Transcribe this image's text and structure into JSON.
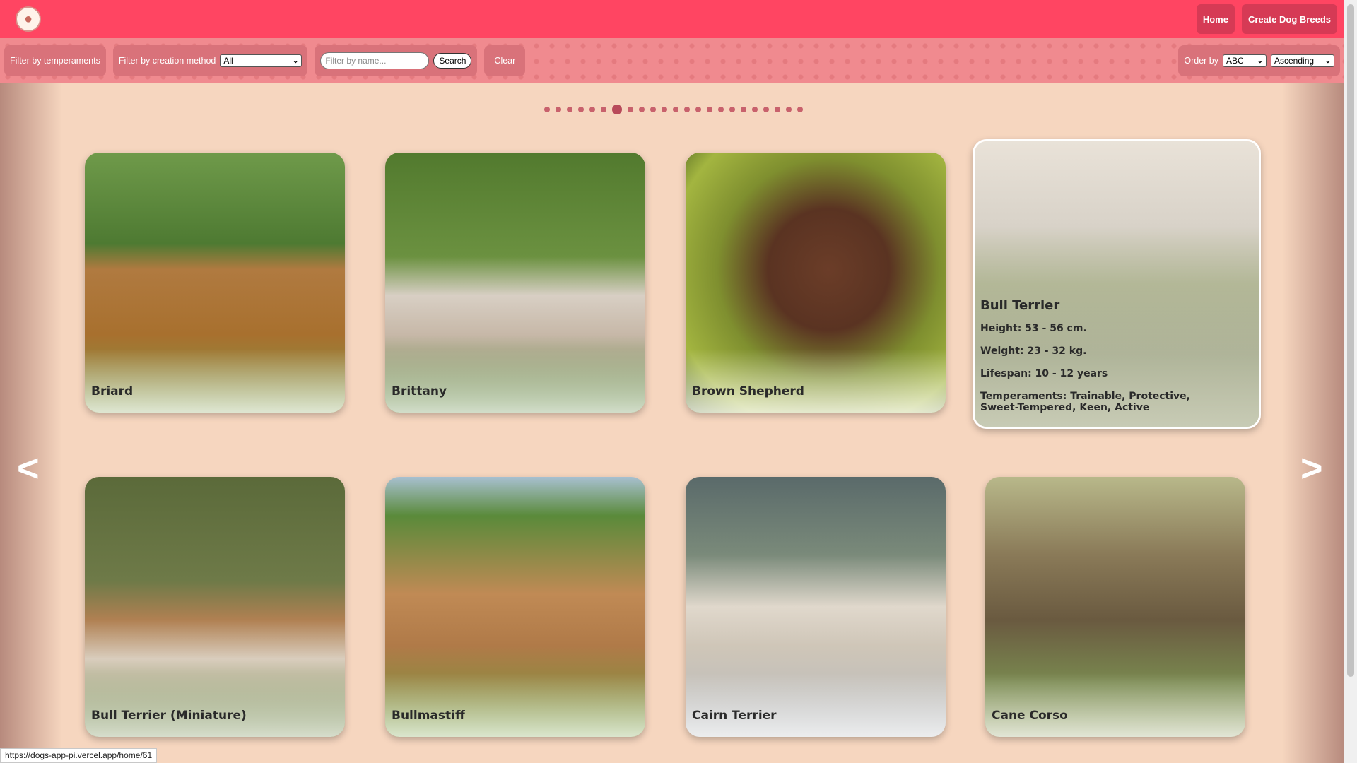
{
  "navbar": {
    "home_label": "Home",
    "create_label": "Create Dog Breeds"
  },
  "filters": {
    "temperaments_label": "Filter by temperaments",
    "creation_label": "Filter by creation method",
    "creation_value": "All",
    "name_placeholder": "Filter by name...",
    "search_label": "Search",
    "clear_label": "Clear",
    "order_label": "Order by",
    "order_by_value": "ABC",
    "order_dir_value": "Ascending"
  },
  "pagination": {
    "total_dots": 23,
    "active_index": 6
  },
  "arrows": {
    "prev": "<",
    "next": ">"
  },
  "cards": [
    {
      "name": "Briard"
    },
    {
      "name": "Brittany"
    },
    {
      "name": "Brown Shepherd"
    },
    {
      "name": "Bull Terrier",
      "height": "Height: 53 - 56 cm.",
      "weight": "Weight: 23 - 32 kg.",
      "lifespan": "Lifespan: 10 - 12 years",
      "temperaments": "Temperaments: Trainable, Protective, Sweet-Tempered, Keen, Active"
    },
    {
      "name": "Bull Terrier (Miniature)"
    },
    {
      "name": "Bullmastiff"
    },
    {
      "name": "Cairn Terrier"
    },
    {
      "name": "Cane Corso"
    }
  ],
  "status_url": "https://dogs-app-pi.vercel.app/home/61",
  "colors": {
    "navbar": "#ff4562",
    "nav_button": "#d63a55",
    "filterbar": "#f08a8f",
    "filter_group": "#d9727a",
    "background": "#f6d6bf",
    "dot": "#c8616c"
  }
}
